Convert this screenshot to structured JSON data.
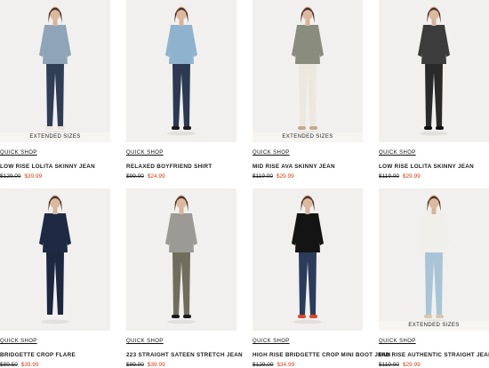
{
  "products": [
    {
      "name": "LOW RISE LOLITA SKINNY JEAN",
      "quick_shop": "QUICK SHOP",
      "original_price": "$129.00",
      "sale_price": "$39.99",
      "badge": "EXTENDED SIZES",
      "top_color": "#8ea4b8",
      "bottom_color": "#2f3e55",
      "shoe_color": "#e8e4dc"
    },
    {
      "name": "RELAXED BOYFRIEND SHIRT",
      "quick_shop": "QUICK SHOP",
      "original_price": "$99.00",
      "sale_price": "$24.99",
      "badge": "",
      "top_color": "#8fb3cf",
      "bottom_color": "#2b3a52",
      "shoe_color": "#1a1a1a"
    },
    {
      "name": "MID RISE AVA SKINNY JEAN",
      "quick_shop": "QUICK SHOP",
      "original_price": "$119.00",
      "sale_price": "$29.99",
      "badge": "EXTENDED SIZES",
      "top_color": "#8a8c7e",
      "bottom_color": "#ece8df",
      "shoe_color": "#c9a98c"
    },
    {
      "name": "LOW RISE LOLITA SKINNY JEAN",
      "quick_shop": "QUICK SHOP",
      "original_price": "$119.00",
      "sale_price": "$29.99",
      "badge": "",
      "top_color": "#3c3c3c",
      "bottom_color": "#2a2a2a",
      "shoe_color": "#111111"
    },
    {
      "name": "BRIDGETTE CROP FLARE",
      "quick_shop": "QUICK SHOP",
      "original_price": "$89.50",
      "sale_price": "$39.99",
      "badge": "",
      "top_color": "#1e2a44",
      "bottom_color": "#1c2740",
      "shoe_color": "#f2f2f2"
    },
    {
      "name": "223 STRAIGHT SATEEN STRETCH JEAN",
      "quick_shop": "QUICK SHOP",
      "original_price": "$99.00",
      "sale_price": "$39.99",
      "badge": "",
      "top_color": "#9c9a94",
      "bottom_color": "#6f6d5c",
      "shoe_color": "#1a1a1a"
    },
    {
      "name": "HIGH RISE BRIDGETTE CROP MINI BOOT JEAN",
      "quick_shop": "QUICK SHOP",
      "original_price": "$129.00",
      "sale_price": "$34.99",
      "badge": "",
      "top_color": "#141414",
      "bottom_color": "#2c3b5c",
      "shoe_color": "#d8472c"
    },
    {
      "name": "MID RISE AUTHENTIC STRAIGHT JEAN",
      "quick_shop": "QUICK SHOP",
      "original_price": "$119.00",
      "sale_price": "$29.99",
      "badge": "EXTENDED SIZES",
      "top_color": "#f1efea",
      "bottom_color": "#a9c4d6",
      "shoe_color": "#d9c8b0"
    }
  ]
}
